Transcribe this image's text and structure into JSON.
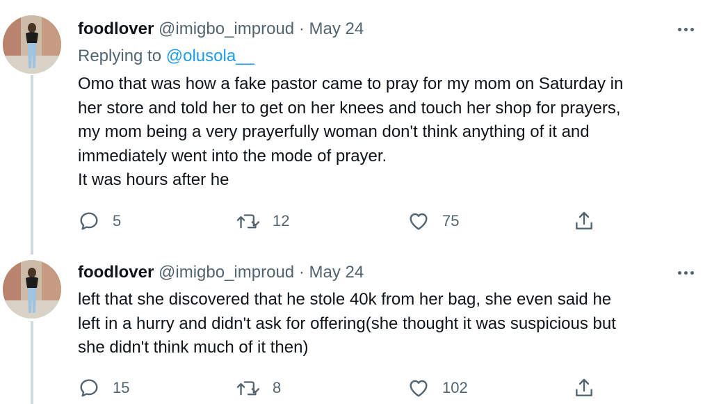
{
  "tweets": [
    {
      "author_name": "foodlover",
      "author_handle": "@imigbo_improud",
      "separator": "·",
      "date": "May 24",
      "replying_prefix": "Replying to",
      "replying_to": "@olusola__",
      "text_lines": [
        "Omo that was how a fake pastor came to pray for my mom on Saturday in",
        "her store and told her to get on her knees and touch her shop for prayers,",
        "my mom being a very prayerfully woman don't think anything of it and",
        "immediately went into the mode of prayer.",
        "It was hours after he"
      ],
      "replies": "5",
      "retweets": "12",
      "likes": "75",
      "icons": [
        "reply-icon",
        "retweet-icon",
        "like-icon",
        "share-icon",
        "more-icon"
      ]
    },
    {
      "author_name": "foodlover",
      "author_handle": "@imigbo_improud",
      "separator": "·",
      "date": "May 24",
      "text_lines": [
        "left that she discovered that he stole 40k from her bag, she even said he",
        "left in a hurry and didn't ask for offering(she thought it was suspicious but",
        "she didn't think much of it then)"
      ],
      "replies": "15",
      "retweets": "8",
      "likes": "102",
      "icons": [
        "reply-icon",
        "retweet-icon",
        "like-icon",
        "share-icon",
        "more-icon"
      ]
    }
  ],
  "colors": {
    "text_primary": "#0f1419",
    "text_secondary": "#536471",
    "link": "#1d9bf0",
    "thread_line": "#cfd9de"
  }
}
